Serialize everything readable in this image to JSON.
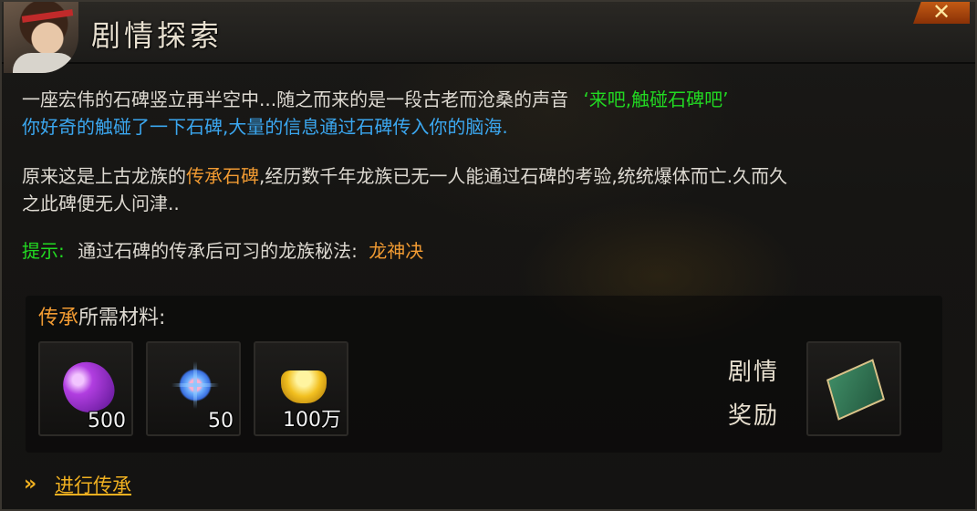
{
  "header": {
    "title": "剧情探索",
    "close_label": "✕"
  },
  "story": {
    "line1_text": "一座宏伟的石碑竖立再半空中...随之而来的是一段古老而沧桑的声音",
    "line1_quote": "‘来吧,触碰石碑吧’",
    "line2_text": "你好奇的触碰了一下石碑,大量的信息通过石碑传入你的脑海.",
    "para2_prefix": "原来这是上古龙族的",
    "para2_highlight": "传承石碑",
    "para2_line1_rest": ",经历数千年龙族已无一人能通过石碑的考验,统统爆体而亡.久而久",
    "para2_line2": "之此碑便无人问津..",
    "hint_label": "提示:",
    "hint_text": "通过石碑的传承后可习的龙族秘法:",
    "hint_value": "龙神决"
  },
  "materials": {
    "title_highlight": "传承",
    "title_rest": "所需材料:",
    "items": [
      {
        "icon": "purple-gem-icon",
        "count": "500"
      },
      {
        "icon": "blue-crystal-icon",
        "count": "50"
      },
      {
        "icon": "gold-ingot-icon",
        "count": "100万"
      }
    ],
    "reward_label_line1": "剧情",
    "reward_label_line2": "奖励",
    "reward_icon": "green-book-icon"
  },
  "action": {
    "label": "进行传承"
  },
  "colors": {
    "green": "#22d922",
    "blue": "#3ba7f0",
    "orange": "#f09a32",
    "gold": "#f0b020"
  }
}
